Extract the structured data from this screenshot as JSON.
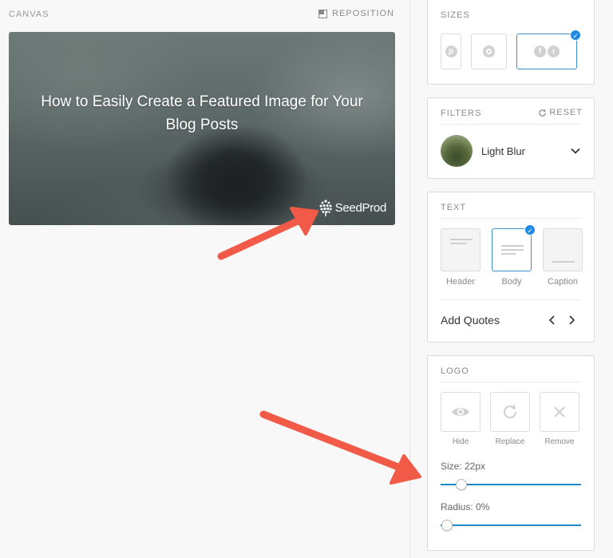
{
  "canvas": {
    "label": "CANVAS",
    "reposition_label": "REPOSITION",
    "image_title": "How to Easily Create a Featured Image for Your Blog Posts",
    "logo_text": "SeedProd"
  },
  "sizes": {
    "heading": "SIZES",
    "options": [
      {
        "icon": "pinterest-icon",
        "selected": false
      },
      {
        "icon": "instagram-icon",
        "selected": false
      },
      {
        "icon": "facebook-twitter-icon",
        "selected": true
      }
    ]
  },
  "filters": {
    "heading": "FILTERS",
    "reset_label": "RESET",
    "selected": "Light Blur"
  },
  "text": {
    "heading": "TEXT",
    "styles": [
      {
        "label": "Header",
        "selected": false
      },
      {
        "label": "Body",
        "selected": true
      },
      {
        "label": "Caption",
        "selected": false
      }
    ],
    "add_quotes_label": "Add Quotes"
  },
  "logo": {
    "heading": "LOGO",
    "buttons": [
      {
        "label": "Hide",
        "icon": "eye-icon"
      },
      {
        "label": "Replace",
        "icon": "refresh-icon"
      },
      {
        "label": "Remove",
        "icon": "close-icon"
      }
    ],
    "size_label": "Size: 22px",
    "size_value_fraction": 0.15,
    "radius_label": "Radius: 0%",
    "radius_value_fraction": 0.0
  },
  "colors": {
    "accent": "#1e88e5",
    "arrow": "#f05a46"
  }
}
